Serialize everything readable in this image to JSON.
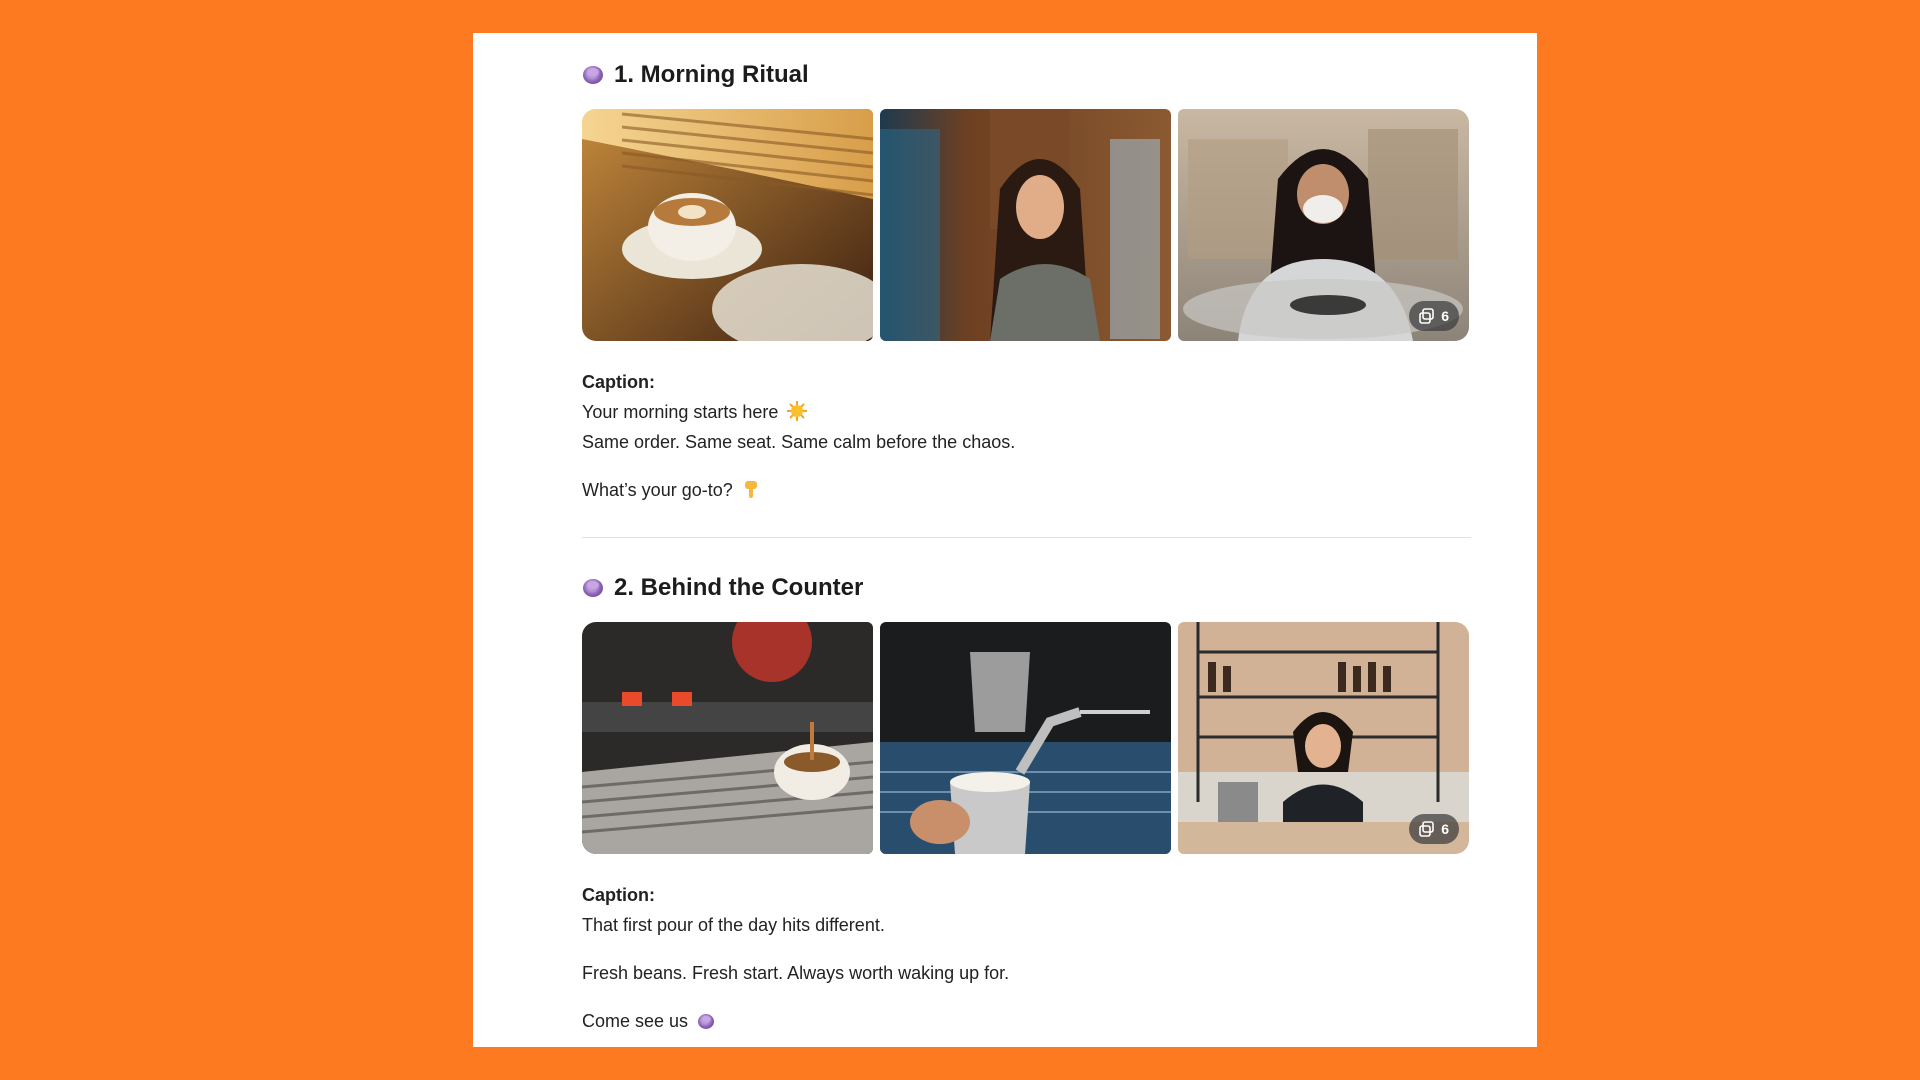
{
  "sections": [
    {
      "title": "1. Morning Ritual",
      "title_icon": "coffee-cup-icon",
      "photo_count": "6",
      "caption_label": "Caption:",
      "lines": [
        "Your morning starts here",
        "Same order. Same seat. Same calm before the chaos.",
        "What’s your go-to?"
      ],
      "line_icons": [
        "sun-emoji-icon",
        "",
        "pointing-down-emoji-icon"
      ]
    },
    {
      "title": "2. Behind the Counter",
      "title_icon": "coffee-cup-icon",
      "photo_count": "6",
      "caption_label": "Caption:",
      "lines": [
        "That first pour of the day hits different.",
        "Fresh beans. Fresh start. Always worth waking up for.",
        "Come see us"
      ],
      "line_icons": [
        "",
        "",
        "coffee-cup-icon"
      ]
    }
  ],
  "colors": {
    "background": "#fe7a21",
    "panel": "#ffffff",
    "divider": "#e1e1e1"
  }
}
